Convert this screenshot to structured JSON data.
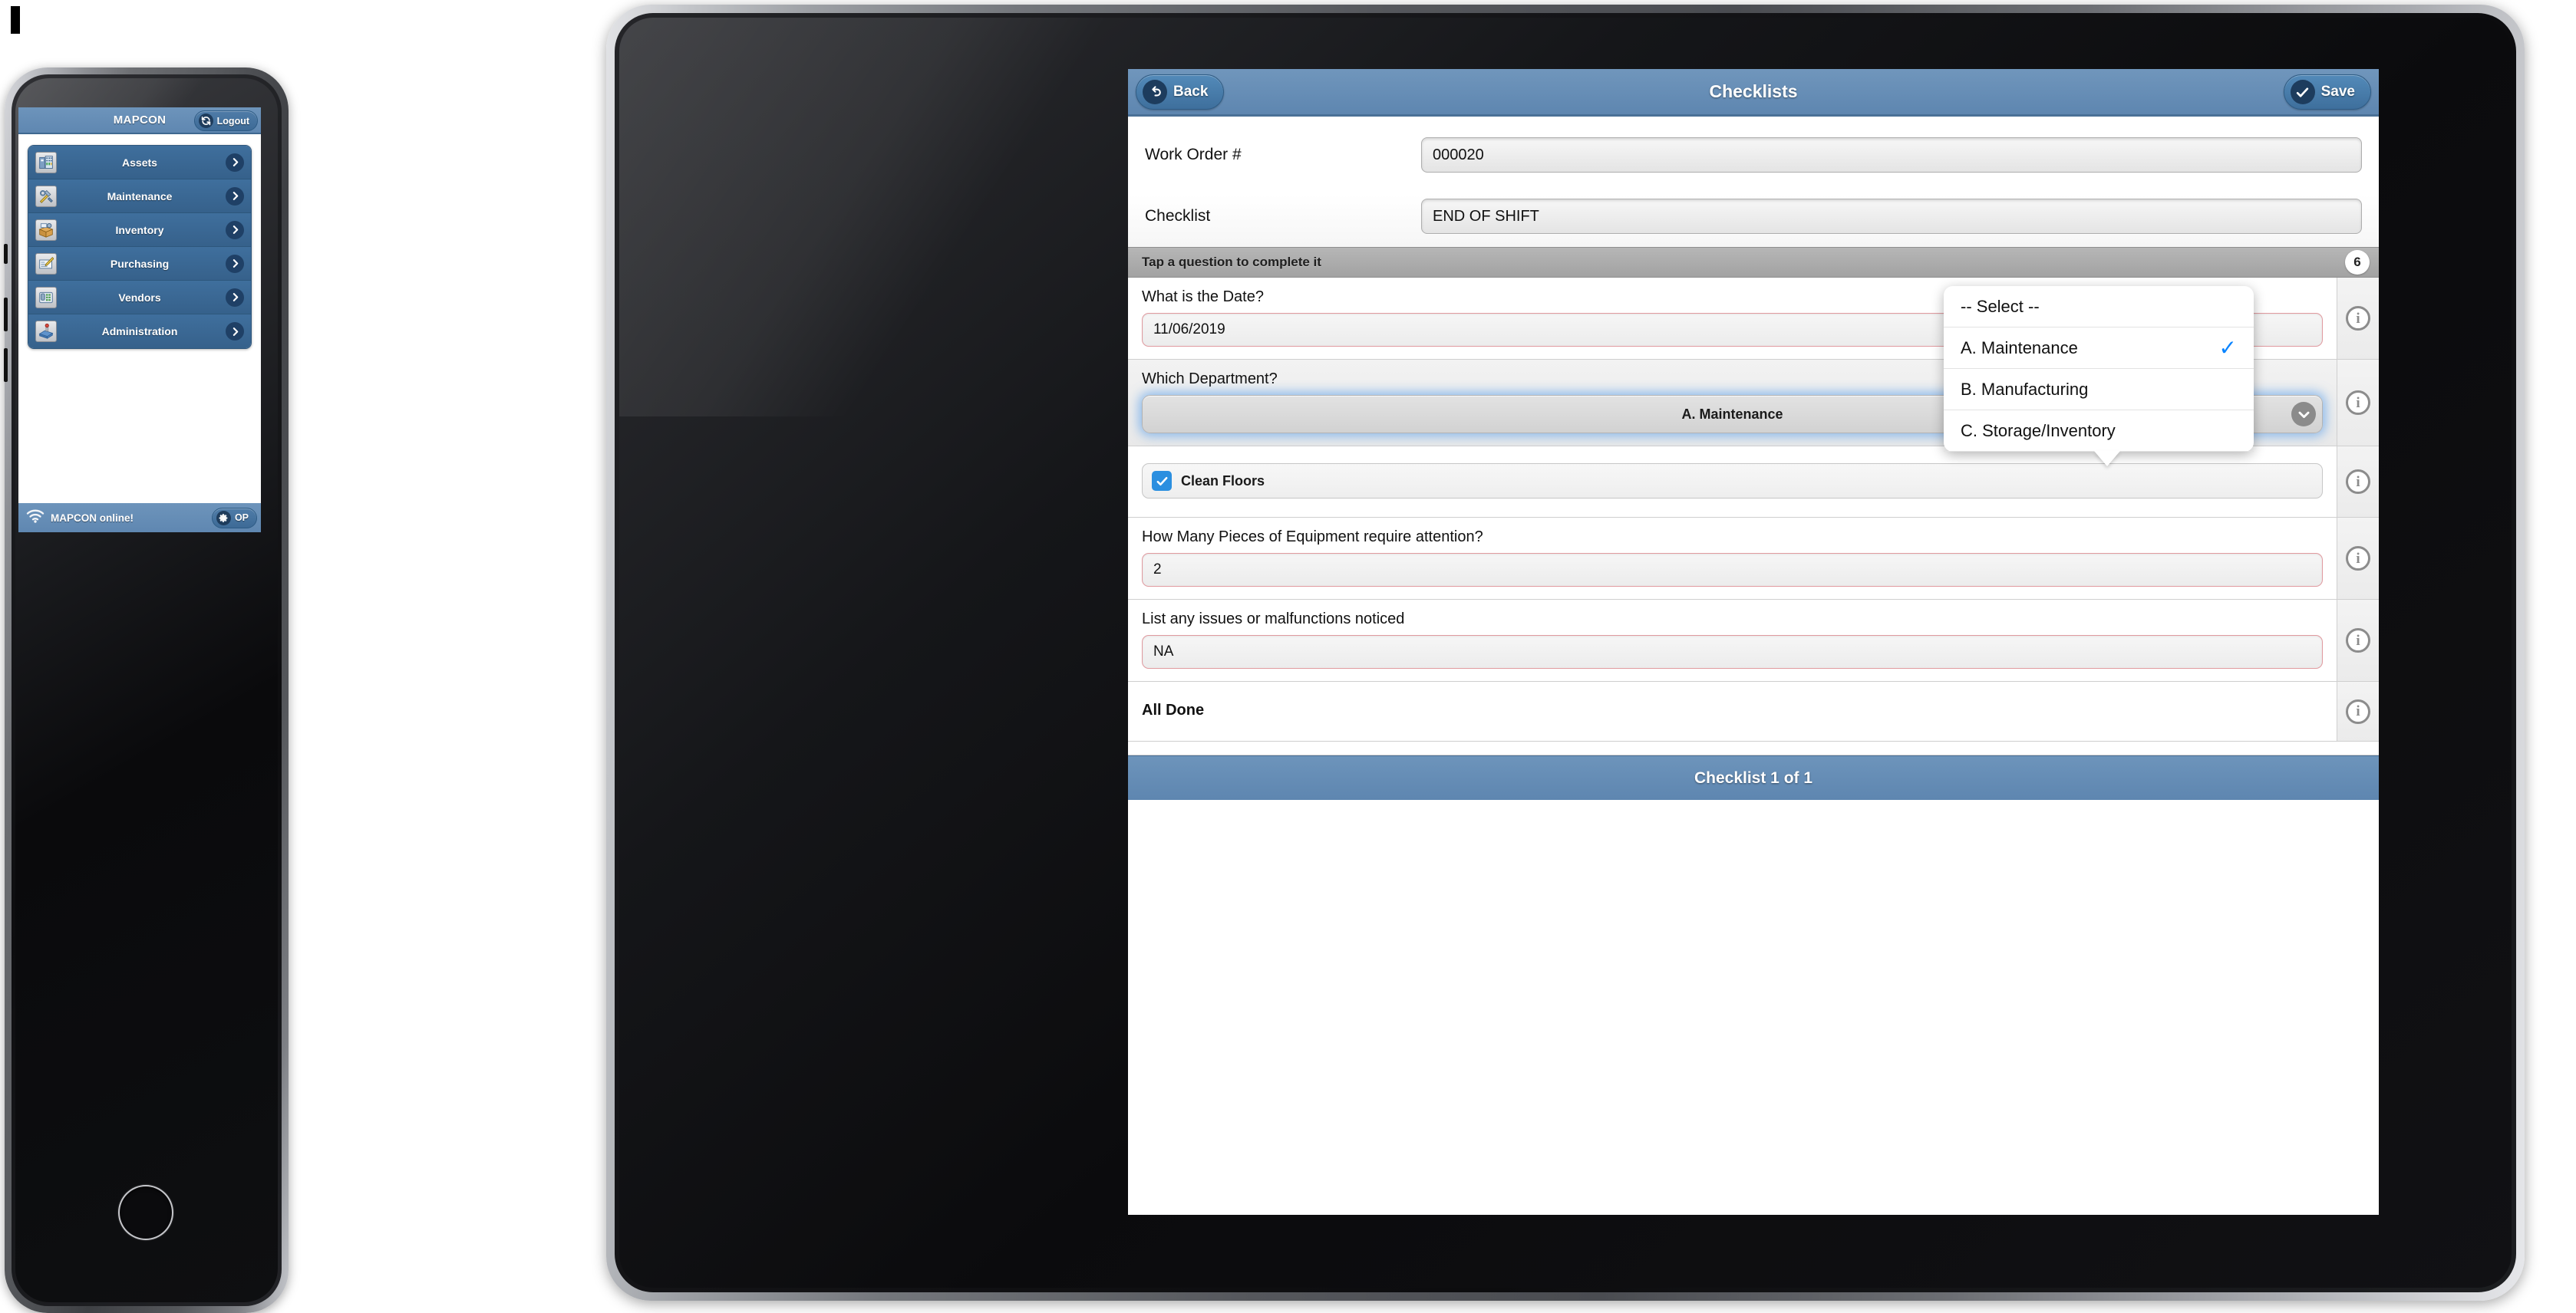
{
  "colors": {
    "brand_blue": "#5f87b1",
    "menu_blue": "#3f6f9d",
    "accent_check": "#0a84ff",
    "checkbox_blue": "#2b8fe0",
    "required_border": "#e09a9f",
    "focus_glow": "#5aa0eb"
  },
  "phone": {
    "navbar": {
      "title": "MAPCON",
      "logout_label": "Logout",
      "logout_icon": "refresh-icon"
    },
    "menu_items": [
      {
        "label": "Assets",
        "icon": "building-icon",
        "chevron": "chevron-right-icon"
      },
      {
        "label": "Maintenance",
        "icon": "tools-icon",
        "chevron": "chevron-right-icon"
      },
      {
        "label": "Inventory",
        "icon": "box-gear-icon",
        "chevron": "chevron-right-icon"
      },
      {
        "label": "Purchasing",
        "icon": "invoice-pen-icon",
        "chevron": "chevron-right-icon"
      },
      {
        "label": "Vendors",
        "icon": "telephone-icon",
        "chevron": "chevron-right-icon"
      },
      {
        "label": "Administration",
        "icon": "stamp-icon",
        "chevron": "chevron-right-icon"
      }
    ],
    "status_bar": {
      "wifi_icon": "wifi-icon",
      "status_text": "MAPCON online!",
      "op_label": "OP",
      "op_icon": "gear-icon"
    }
  },
  "tablet": {
    "navbar": {
      "back_label": "Back",
      "back_icon": "back-arrow-icon",
      "title": "Checklists",
      "save_label": "Save",
      "save_icon": "checkmark-icon"
    },
    "header_fields": [
      {
        "label": "Work Order #",
        "value": "000020"
      },
      {
        "label": "Checklist",
        "value": "END OF SHIFT"
      }
    ],
    "section_bar": {
      "title": "Tap a question to complete it",
      "badge": "6"
    },
    "questions": [
      {
        "text": "What is the Date?",
        "type": "date",
        "value": "11/06/2019",
        "trailing_icon": "calendar-icon",
        "info_icon": "info-icon"
      },
      {
        "text": "Which Department?",
        "type": "select",
        "value": "A. Maintenance",
        "trailing_icon": "chevron-down-icon",
        "info_icon": "info-icon"
      },
      {
        "text": "",
        "type": "checkbox",
        "value": "Clean Floors",
        "checked": true,
        "trailing_icon": "check-icon",
        "info_icon": "info-icon"
      },
      {
        "text": "How Many Pieces of Equipment require attention?",
        "type": "number",
        "value": "2",
        "info_icon": "info-icon"
      },
      {
        "text": "List any issues or malfunctions noticed",
        "type": "text",
        "value": "NA",
        "info_icon": "info-icon"
      },
      {
        "text": "All Done",
        "type": "label",
        "value": "",
        "info_icon": "info-icon"
      }
    ],
    "footer": {
      "text": "Checklist 1 of 1"
    },
    "dropdown": {
      "options": [
        {
          "label": "-- Select --",
          "selected": false
        },
        {
          "label": "A. Maintenance",
          "selected": true
        },
        {
          "label": "B. Manufacturing",
          "selected": false
        },
        {
          "label": "C. Storage/Inventory",
          "selected": false
        }
      ],
      "check_glyph": "✓"
    }
  }
}
